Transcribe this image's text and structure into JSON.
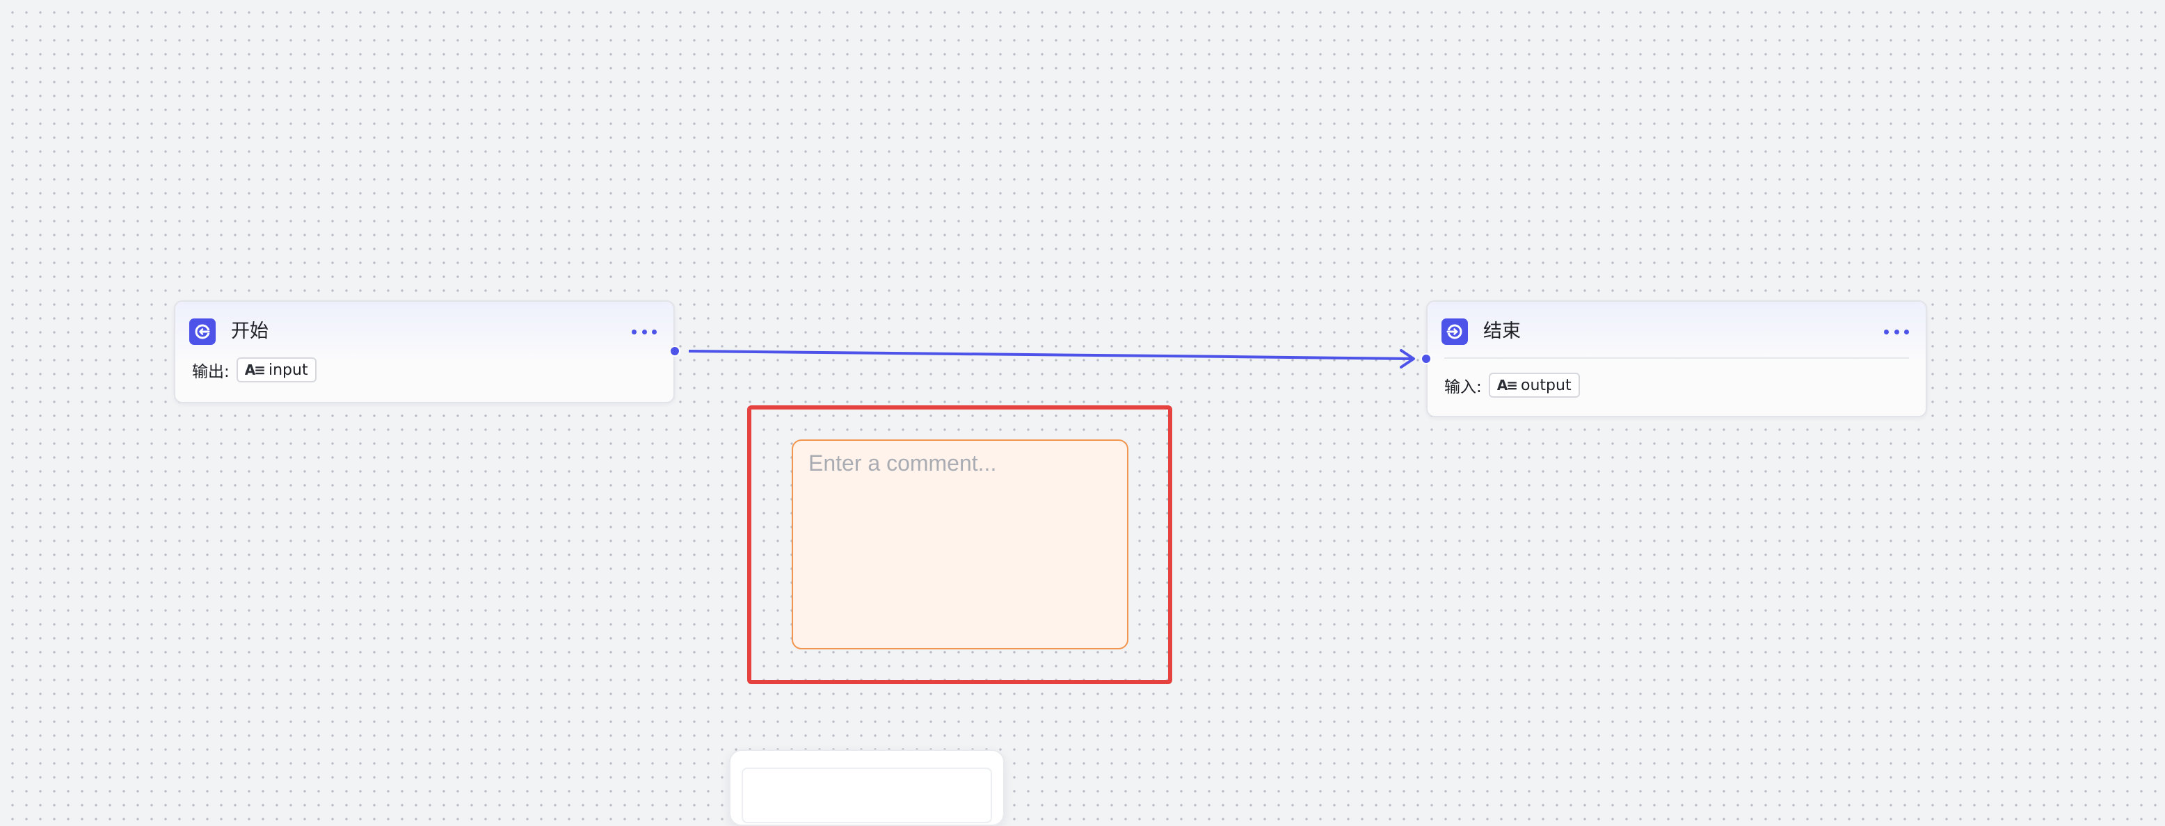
{
  "nodes": {
    "start": {
      "title": "开始",
      "port_label": "输出:",
      "variable": "input",
      "icon": "start-node-icon"
    },
    "end": {
      "title": "结束",
      "port_label": "输入:",
      "variable": "output",
      "icon": "end-node-icon"
    }
  },
  "comment": {
    "placeholder": "Enter a comment..."
  },
  "colors": {
    "accent": "#4d53e8",
    "selection": "#e5413e",
    "comment_border": "#f2964f",
    "comment_fill": "#fff3eb"
  }
}
